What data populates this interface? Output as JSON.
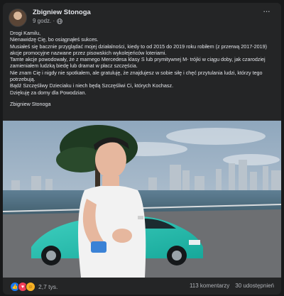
{
  "post": {
    "author": "Zbigniew Stonoga",
    "time": "9 godz. ·",
    "paragraphs": [
      "Drogi Kamilu,",
      "Nienawidzę Cię, bo osiągnąłeś sukces.",
      "Musiałeś się bacznie przyglądać mojej działalności, kiedy to od 2015 do 2019 roku robiłem (z przerwą 2017-2019) akcje promocyjne nazwane przez pisowskich wykolejeńców loteriami.",
      "Tamte akcje powodowały, że z marnego Mercedesa klasy S lub prymitywnej M- trójki w ciągu doby, jak czarodziej zamieniałem ludzką biedę lub dramat w płacz szczęścia.",
      "Nie znam Cię i nigdy nie spotkałem, ale gratuluję, że znajdujesz w sobie siłę i chęć przytulania ludzi, którzy tego potrzebują.",
      "Bądź Szczęśliwy Dzieciaku i niech będą Szczęśliwi Ci, których Kochasz.",
      "Dziękuję za domy dla Powodzian."
    ],
    "signature": "Zbigniew Stonoga"
  },
  "footer": {
    "reaction_count": "2,7 tys.",
    "comments": "113 komentarzy",
    "shares": "30 udostępnień",
    "reaction_icons": [
      "like-icon",
      "love-icon",
      "hug-icon"
    ]
  },
  "colors": {
    "background": "#18191a",
    "card": "#242526",
    "text_primary": "#e4e6eb",
    "text_secondary": "#b0b3b8",
    "like_blue": "#1877f2",
    "love_red": "#f33e58",
    "hug_yellow": "#f7b125"
  }
}
